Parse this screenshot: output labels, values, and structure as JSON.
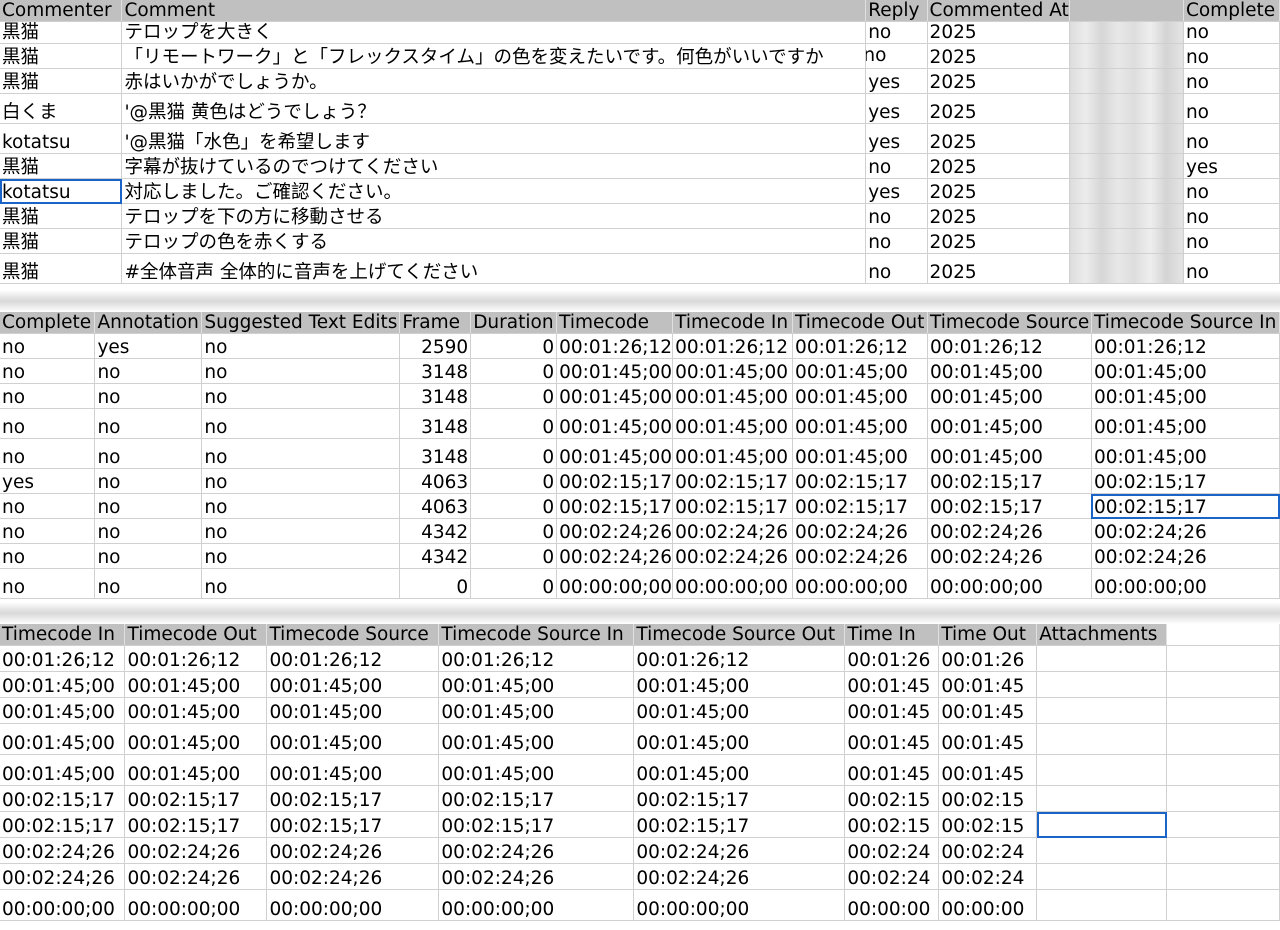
{
  "section1": {
    "headers": [
      "Commenter",
      "Comment",
      "Reply",
      "Commented At",
      "",
      "Complete"
    ],
    "rows": [
      {
        "commenter": "黒猫",
        "comment": "テロップを大きく",
        "reply": "no",
        "at": "2025",
        "complete": "no"
      },
      {
        "commenter": "黒猫",
        "comment": "「リモートワーク」と「フレックスタイム」の色を変えたいです。何色がいいですか",
        "reply": "no",
        "at": "2025",
        "complete": "no"
      },
      {
        "commenter": "黒猫",
        "comment": "赤はいかがでしょうか。",
        "reply": "yes",
        "at": "2025",
        "complete": "no"
      },
      {
        "commenter": "白くま",
        "comment": "'@黒猫 黄色はどうでしょう？",
        "reply": "yes",
        "at": "2025",
        "complete": "no"
      },
      {
        "commenter": "kotatsu",
        "comment": "'@黒猫「水色」を希望します",
        "reply": "yes",
        "at": "2025",
        "complete": "no"
      },
      {
        "commenter": "黒猫",
        "comment": "字幕が抜けているのでつけてください",
        "reply": "no",
        "at": "2025",
        "complete": "yes"
      },
      {
        "commenter": "kotatsu",
        "comment": "対応しました。ご確認ください。",
        "reply": "yes",
        "at": "2025",
        "complete": "no"
      },
      {
        "commenter": "黒猫",
        "comment": "テロップを下の方に移動させる",
        "reply": "no",
        "at": "2025",
        "complete": "no"
      },
      {
        "commenter": "黒猫",
        "comment": "テロップの色を赤くする",
        "reply": "no",
        "at": "2025",
        "complete": "no"
      },
      {
        "commenter": "黒猫",
        "comment": "#全体音声 全体的に音声を上げてください",
        "reply": "no",
        "at": "2025",
        "complete": "no"
      }
    ]
  },
  "section2": {
    "headers": [
      "Complete",
      "Annotation",
      "Suggested Text Edits",
      "Frame",
      "Duration",
      "Timecode",
      "Timecode In",
      "Timecode Out",
      "Timecode Source",
      "Timecode Source In"
    ],
    "rows": [
      [
        "no",
        "yes",
        "no",
        "2590",
        "0",
        "00:01:26;12",
        "00:01:26;12",
        "00:01:26;12",
        "00:01:26;12",
        "00:01:26;12"
      ],
      [
        "no",
        "no",
        "no",
        "3148",
        "0",
        "00:01:45;00",
        "00:01:45;00",
        "00:01:45;00",
        "00:01:45;00",
        "00:01:45;00"
      ],
      [
        "no",
        "no",
        "no",
        "3148",
        "0",
        "00:01:45;00",
        "00:01:45;00",
        "00:01:45;00",
        "00:01:45;00",
        "00:01:45;00"
      ],
      [
        "no",
        "no",
        "no",
        "3148",
        "0",
        "00:01:45;00",
        "00:01:45;00",
        "00:01:45;00",
        "00:01:45;00",
        "00:01:45;00"
      ],
      [
        "no",
        "no",
        "no",
        "3148",
        "0",
        "00:01:45;00",
        "00:01:45;00",
        "00:01:45;00",
        "00:01:45;00",
        "00:01:45;00"
      ],
      [
        "yes",
        "no",
        "no",
        "4063",
        "0",
        "00:02:15;17",
        "00:02:15;17",
        "00:02:15;17",
        "00:02:15;17",
        "00:02:15;17"
      ],
      [
        "no",
        "no",
        "no",
        "4063",
        "0",
        "00:02:15;17",
        "00:02:15;17",
        "00:02:15;17",
        "00:02:15;17",
        "00:02:15;17"
      ],
      [
        "no",
        "no",
        "no",
        "4342",
        "0",
        "00:02:24;26",
        "00:02:24;26",
        "00:02:24;26",
        "00:02:24;26",
        "00:02:24;26"
      ],
      [
        "no",
        "no",
        "no",
        "4342",
        "0",
        "00:02:24;26",
        "00:02:24;26",
        "00:02:24;26",
        "00:02:24;26",
        "00:02:24;26"
      ],
      [
        "no",
        "no",
        "no",
        "0",
        "0",
        "00:00:00;00",
        "00:00:00;00",
        "00:00:00;00",
        "00:00:00;00",
        "00:00:00;00"
      ]
    ]
  },
  "section3": {
    "headers": [
      "Timecode In",
      "Timecode Out",
      "Timecode Source",
      "Timecode Source In",
      "Timecode Source Out",
      "Time In",
      "Time Out",
      "Attachments",
      ""
    ],
    "rows": [
      [
        "00:01:26;12",
        "00:01:26;12",
        "00:01:26;12",
        "00:01:26;12",
        "00:01:26;12",
        "00:01:26",
        "00:01:26",
        "",
        ""
      ],
      [
        "00:01:45;00",
        "00:01:45;00",
        "00:01:45;00",
        "00:01:45;00",
        "00:01:45;00",
        "00:01:45",
        "00:01:45",
        "",
        ""
      ],
      [
        "00:01:45;00",
        "00:01:45;00",
        "00:01:45;00",
        "00:01:45;00",
        "00:01:45;00",
        "00:01:45",
        "00:01:45",
        "",
        ""
      ],
      [
        "00:01:45;00",
        "00:01:45;00",
        "00:01:45;00",
        "00:01:45;00",
        "00:01:45;00",
        "00:01:45",
        "00:01:45",
        "",
        ""
      ],
      [
        "00:01:45;00",
        "00:01:45;00",
        "00:01:45;00",
        "00:01:45;00",
        "00:01:45;00",
        "00:01:45",
        "00:01:45",
        "",
        ""
      ],
      [
        "00:02:15;17",
        "00:02:15;17",
        "00:02:15;17",
        "00:02:15;17",
        "00:02:15;17",
        "00:02:15",
        "00:02:15",
        "",
        ""
      ],
      [
        "00:02:15;17",
        "00:02:15;17",
        "00:02:15;17",
        "00:02:15;17",
        "00:02:15;17",
        "00:02:15",
        "00:02:15",
        "",
        ""
      ],
      [
        "00:02:24;26",
        "00:02:24;26",
        "00:02:24;26",
        "00:02:24;26",
        "00:02:24;26",
        "00:02:24",
        "00:02:24",
        "",
        ""
      ],
      [
        "00:02:24;26",
        "00:02:24;26",
        "00:02:24;26",
        "00:02:24;26",
        "00:02:24;26",
        "00:02:24",
        "00:02:24",
        "",
        ""
      ],
      [
        "00:00:00;00",
        "00:00:00;00",
        "00:00:00;00",
        "00:00:00;00",
        "00:00:00;00",
        "00:00:00",
        "00:00:00",
        "",
        ""
      ]
    ]
  },
  "colors": {
    "selection": "#1a64c8",
    "header_bg": "#c0c0c0",
    "grid": "#d0d0d0"
  }
}
